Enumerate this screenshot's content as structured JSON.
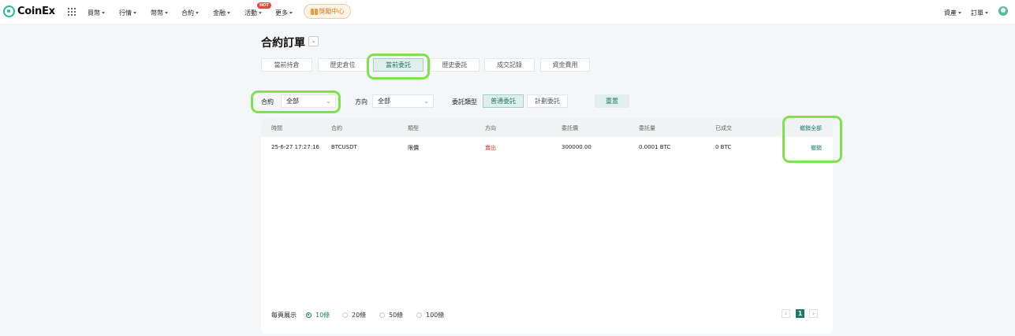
{
  "nav": {
    "logo": "CoinEx",
    "menu": [
      "買幣",
      "行情",
      "幣幣",
      "合約",
      "金融",
      "活動",
      "更多"
    ],
    "hot_badge": "HOT",
    "reward": "獎勵中心",
    "right": [
      "資產",
      "訂單"
    ]
  },
  "page": {
    "title": "合約訂單",
    "tabs": [
      "當前持倉",
      "歷史倉位",
      "當前委託",
      "歷史委託",
      "成交記錄",
      "資金費用"
    ],
    "active_tab": "當前委託"
  },
  "filters": {
    "contract_label": "合約",
    "contract_value": "全部",
    "direction_label": "方向",
    "direction_value": "全部",
    "type_label": "委託類型",
    "type_options": [
      "普通委託",
      "計劃委託"
    ],
    "reset": "重置"
  },
  "table": {
    "headers": [
      "時間",
      "合約",
      "類型",
      "方向",
      "委託價",
      "委託量",
      "已成交",
      "撤銷全部"
    ],
    "rows": [
      {
        "time": "25-6-27 17:27:16",
        "contract": "BTCUSDT",
        "type": "限價",
        "side": "賣出",
        "price": "300000.00",
        "amount": "0.0001 BTC",
        "filled": "0 BTC",
        "action": "撤銷"
      }
    ]
  },
  "pagination": {
    "per_page_label": "每頁展示",
    "options": [
      "10條",
      "20條",
      "50條",
      "100條"
    ],
    "selected": "10條",
    "current_page": "1"
  },
  "colors": {
    "accent": "#1d7a6b",
    "sell": "#e0342c",
    "highlight": "#7ee24f"
  }
}
